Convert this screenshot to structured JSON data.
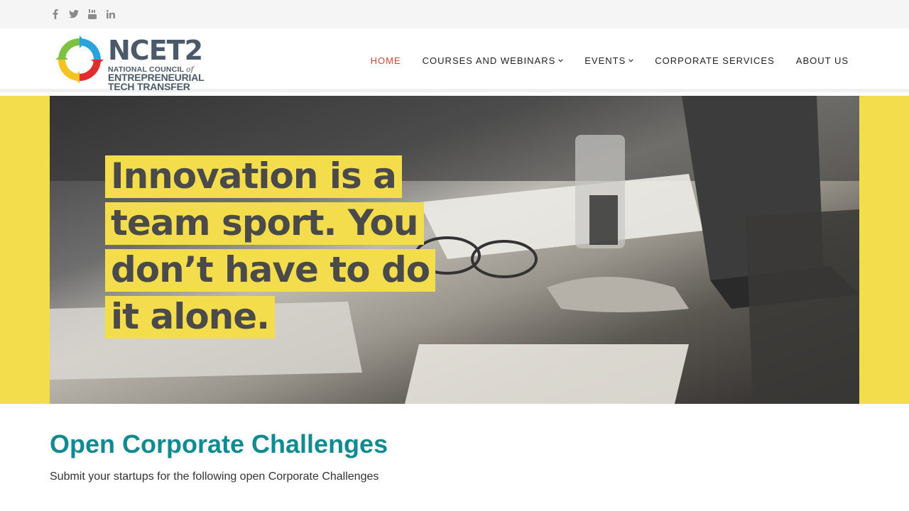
{
  "social": {
    "icons": [
      "facebook-icon",
      "twitter-icon",
      "youtube-icon",
      "linkedin-icon"
    ]
  },
  "logo": {
    "brand": "NCET2",
    "line1": "NATIONAL COUNCIL",
    "line1_of": "of",
    "line2": "ENTREPRENEURIAL",
    "line3": "TECH TRANSFER"
  },
  "nav": {
    "items": [
      {
        "label": "HOME",
        "active": true
      },
      {
        "label": "COURSES AND WEBINARS",
        "dropdown": true
      },
      {
        "label": "EVENTS",
        "dropdown": true
      },
      {
        "label": "CORPORATE SERVICES"
      },
      {
        "label": "ABOUT US"
      }
    ]
  },
  "hero": {
    "quote_lines": [
      "Innovation is a",
      "team sport. You",
      "don’t have to do",
      "it alone."
    ]
  },
  "main": {
    "title": "Open Corporate Challenges",
    "subtitle": "Submit your startups for the following open Corporate Challenges"
  },
  "colors": {
    "accent_yellow": "#f3dd4c",
    "title_teal": "#128a92",
    "nav_active": "#d9443a"
  }
}
